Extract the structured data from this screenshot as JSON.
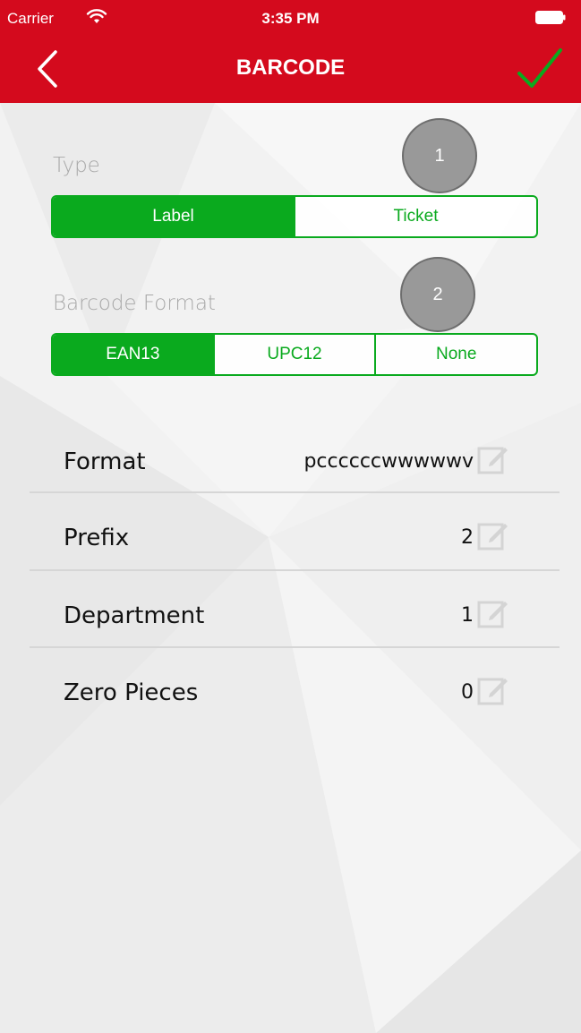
{
  "status_bar": {
    "carrier": "Carrier",
    "time": "3:35 PM",
    "wifi_icon": "wifi-icon",
    "battery_icon": "battery-icon"
  },
  "nav": {
    "title": "BARCODE",
    "back_icon": "chevron-left-icon",
    "confirm_icon": "checkmark-icon"
  },
  "colors": {
    "header": "#d40a1d",
    "accent": "#0aaa1e"
  },
  "type_section": {
    "label": "Type",
    "badge": "1",
    "options": [
      "Label",
      "Ticket"
    ],
    "selected": "Label"
  },
  "format_section": {
    "label": "Barcode Format",
    "badge": "2",
    "options": [
      "EAN13",
      "UPC12",
      "None"
    ],
    "selected": "EAN13"
  },
  "fields": [
    {
      "label": "Format",
      "value": "pccccccwwwwwv",
      "icon": "edit-icon"
    },
    {
      "label": "Prefix",
      "value": "2",
      "icon": "edit-icon"
    },
    {
      "label": "Department",
      "value": "1",
      "icon": "edit-icon"
    },
    {
      "label": "Zero Pieces",
      "value": "0",
      "icon": "edit-icon"
    }
  ]
}
